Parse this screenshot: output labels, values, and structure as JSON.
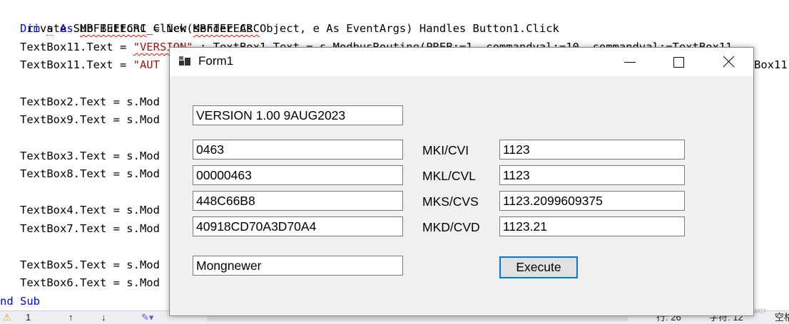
{
  "code": {
    "line1": {
      "a": "rivate Sub Button1_Click(sender As Object, e As EventArgs) Handles Button1.Click"
    },
    "line2": {
      "a": "   Dim ",
      "b": "s",
      "c": " As ",
      "d": "MBFIEEECRC",
      "e": " = New ",
      "f": "MBFIEEECRC"
    },
    "line3": {
      "a": "   TextBox11.Text = ",
      "b": "\"VERSION\"",
      "c": " : TextBox1.Text = s.ModbusRoutine(PREB:=1, commandval:=10, commandval:=TextBox11."
    },
    "line4": {
      "a": "   TextBox11.Text = ",
      "b": "\"AUT",
      "c": "Box11."
    },
    "line6": "   TextBox2.Text = s.Mod",
    "line7": "   TextBox9.Text = s.Mod",
    "line9": "   TextBox3.Text = s.Mod",
    "line10": "   TextBox8.Text = s.Mod",
    "line12": "   TextBox4.Text = s.Mod",
    "line13": "   TextBox7.Text = s.Mod",
    "line15": "   TextBox5.Text = s.Mod",
    "line16": "   TextBox6.Text = s.Mod",
    "line17": "nd Sub"
  },
  "status_bar": {
    "warnings": "1",
    "up_arrow": "↑",
    "down_arrow": "↓",
    "row": "行: 26",
    "chars": "字符: 12",
    "tail": "空格"
  },
  "watermark": "CSDN @Mongnewer",
  "form": {
    "title": "Form1",
    "version_box": "VERSION 1.00 9AUG2023",
    "rows": [
      {
        "hex": "0463",
        "label": "MKI/CVI",
        "value": "1123"
      },
      {
        "hex": "00000463",
        "label": "MKL/CVL",
        "value": "1123"
      },
      {
        "hex": "448C66B8",
        "label": "MKS/CVS",
        "value": "1123.2099609375"
      },
      {
        "hex": "40918CD70A3D70A4",
        "label": "MKD/CVD",
        "value": "1123.21"
      }
    ],
    "name_box": "Mongnewer",
    "execute_label": "Execute"
  }
}
